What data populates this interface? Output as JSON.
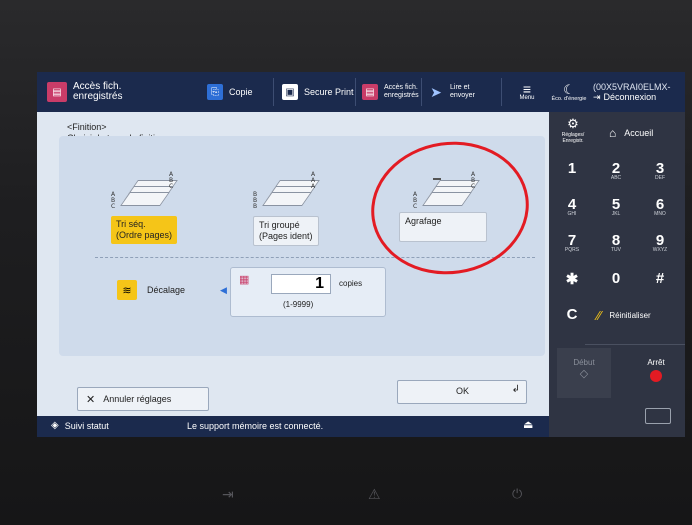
{
  "topbar": {
    "current_app": "Accès fich.\nenregistrés",
    "items": [
      {
        "label": "Copie",
        "icon": "copy-icon"
      },
      {
        "label": "Secure Print",
        "icon": "printer-icon"
      },
      {
        "label": "Accès fich.\nenregistrés",
        "icon": "stored-files-icon"
      },
      {
        "label": "Lire et\nenvoyer",
        "icon": "send-icon"
      }
    ],
    "menu_label": "Menu",
    "energy_label": "Éco. d'énergie",
    "user_id": "(00X5VRAI0ELMX-",
    "logout_label": "Déconnexion"
  },
  "page": {
    "title": "<Finition>",
    "subtitle": "Choisir le type de finition."
  },
  "finishing": {
    "options": [
      {
        "label": "Tri séq.\n(Ordre pages)",
        "selected": true
      },
      {
        "label": "Tri groupé\n(Pages ident)",
        "selected": false
      },
      {
        "label": "Agrafage",
        "selected": false
      }
    ],
    "offset_label": "Décalage",
    "copies_value": "1",
    "copies_unit": "copies",
    "copies_range": "(1-9999)"
  },
  "actions": {
    "cancel_label": "Annuler réglages",
    "ok_label": "OK"
  },
  "right": {
    "settings_label": "Réglages/\nEnregistr.",
    "home_label": "Accueil",
    "keys": [
      {
        "main": "1",
        "sub": ""
      },
      {
        "main": "2",
        "sub": "ABC"
      },
      {
        "main": "3",
        "sub": "DEF"
      },
      {
        "main": "4",
        "sub": "GHI"
      },
      {
        "main": "5",
        "sub": "JKL"
      },
      {
        "main": "6",
        "sub": "MNO"
      },
      {
        "main": "7",
        "sub": "PQRS"
      },
      {
        "main": "8",
        "sub": "TUV"
      },
      {
        "main": "9",
        "sub": "WXYZ"
      },
      {
        "main": "✱",
        "sub": ""
      },
      {
        "main": "0",
        "sub": ""
      },
      {
        "main": "#",
        "sub": ""
      }
    ],
    "clear_label": "C",
    "reset_label": "Réinitialiser",
    "start_label": "Début",
    "stop_label": "Arrêt"
  },
  "status": {
    "monitor_label": "Suivi statut",
    "message": "Le support mémoire est connecté."
  },
  "colors": {
    "accent_yellow": "#f5c518",
    "annotation_red": "#e31b23",
    "topbar_navy": "#1b2a4d"
  }
}
